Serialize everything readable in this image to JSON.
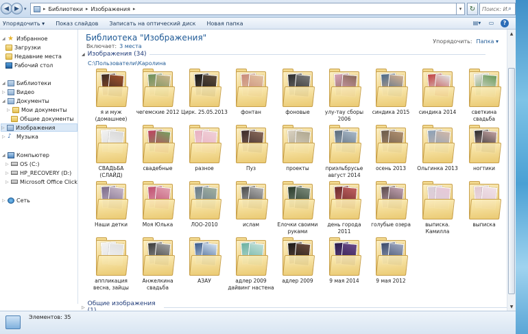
{
  "address": {
    "crumbs": [
      "Библиотеки",
      "Изображения"
    ],
    "search_placeholder": "Поиск: Из..."
  },
  "toolbar": {
    "buttons": [
      "Упорядочить ▾",
      "Показ слайдов",
      "Записать на оптический диск",
      "Новая папка"
    ]
  },
  "nav": {
    "items": [
      {
        "label": "Избранное",
        "icon": "star-icon"
      },
      {
        "label": "Загрузки",
        "icon": "folder-icon"
      },
      {
        "label": "Недавние места",
        "icon": "folder-icon"
      },
      {
        "label": "Рабочий стол",
        "icon": "desktop-icon"
      },
      {
        "label": "Библиотеки",
        "icon": "library-icon"
      },
      {
        "label": "Видео",
        "icon": "library-icon"
      },
      {
        "label": "Документы",
        "icon": "library-icon"
      },
      {
        "label": "Мои документы",
        "icon": "folder-icon"
      },
      {
        "label": "Общие документы",
        "icon": "folder-icon"
      },
      {
        "label": "Изображения",
        "icon": "library-icon"
      },
      {
        "label": "Музыка",
        "icon": "music-icon"
      },
      {
        "label": "Компьютер",
        "icon": "computer-icon"
      },
      {
        "label": "OS (C:)",
        "icon": "drive-icon"
      },
      {
        "label": "HP_RECOVERY (D:)",
        "icon": "drive-icon"
      },
      {
        "label": "Microsoft Office Click-to-Run",
        "icon": "drive-icon"
      },
      {
        "label": "Сеть",
        "icon": "network-icon"
      }
    ]
  },
  "content": {
    "title": "Библиотека \"Изображения\"",
    "includes_label": "Включает:",
    "includes_link": "3 места",
    "arrange_label": "Упорядочить:",
    "arrange_value": "Папка ▾",
    "group1": "Изображения (34)",
    "group1_path": "C:\\Пользователи\\Каролина",
    "group2": "Общие изображения (1)"
  },
  "folders": [
    {
      "name": "я и муж (домашнее)",
      "c1": "#3a2a22",
      "c2": "#a0522d"
    },
    {
      "name": "чегемские 2012",
      "c1": "#6b8f5a",
      "c2": "#c9b48a"
    },
    {
      "name": "Цирк. 25.05.2013",
      "c1": "#1a1a1a",
      "c2": "#5c4a3a"
    },
    {
      "name": "фонтан",
      "c1": "#c88a7a",
      "c2": "#e3c2a0"
    },
    {
      "name": "фоновые",
      "c1": "#2c2c2c",
      "c2": "#7a7a7a"
    },
    {
      "name": "улу-тау сборы 2006",
      "c1": "#d7a3b8",
      "c2": "#8a6a5a"
    },
    {
      "name": "синдика 2015",
      "c1": "#4a6a8a",
      "c2": "#d4b090"
    },
    {
      "name": "синдика 2014",
      "c1": "#c04040",
      "c2": "#e0e0e0"
    },
    {
      "name": "светкина свадьба",
      "c1": "#e8e4e0",
      "c2": "#6a9a5a"
    },
    {
      "name": "СВАДЬБА (СЛАЙД)",
      "c1": "#f2f2f2",
      "c2": "#d8d8d8"
    },
    {
      "name": "свадебные",
      "c1": "#c04060",
      "c2": "#78a060"
    },
    {
      "name": "разное",
      "c1": "#e8b0c0",
      "c2": "#f0d0d8"
    },
    {
      "name": "Пуз",
      "c1": "#3a2a2a",
      "c2": "#8a6a5a"
    },
    {
      "name": "проекты",
      "c1": "#d8d0c0",
      "c2": "#b0a890"
    },
    {
      "name": "приэльбрусье август 2014",
      "c1": "#5a6a7a",
      "c2": "#a8b8c8"
    },
    {
      "name": "осень 2013",
      "c1": "#6a5a4a",
      "c2": "#b09070"
    },
    {
      "name": "Ольгинка 2013",
      "c1": "#8aa0b8",
      "c2": "#d0b8a8"
    },
    {
      "name": "ногтики",
      "c1": "#2a2a2a",
      "c2": "#c0a0a0"
    },
    {
      "name": "Наши детки",
      "c1": "#7a6a8a",
      "c2": "#c8b8c8"
    },
    {
      "name": "Моя Юлька",
      "c1": "#c05070",
      "c2": "#e0a0b0"
    },
    {
      "name": "ЛОО-2010",
      "c1": "#6a7a8a",
      "c2": "#a0b0a0"
    },
    {
      "name": "ислам",
      "c1": "#4a4a4a",
      "c2": "#b0b0b0"
    },
    {
      "name": "Елочки своими руками",
      "c1": "#2a3a2a",
      "c2": "#7a8a7a"
    },
    {
      "name": "день города 2011",
      "c1": "#6a2a2a",
      "c2": "#c06060"
    },
    {
      "name": "голубые озера",
      "c1": "#5a4a4a",
      "c2": "#c0a0b0"
    },
    {
      "name": "выписка. Камилла",
      "c1": "#d8d0d8",
      "c2": "#e8c8d8"
    },
    {
      "name": "выписка",
      "c1": "#e0c8d0",
      "c2": "#f0e0e8"
    },
    {
      "name": "аппликация весна, зайцы",
      "c1": "#f2f2f2",
      "c2": "#e0e0e0"
    },
    {
      "name": "Анжелкина свадьба",
      "c1": "#3a3a3a",
      "c2": "#a0a0a0"
    },
    {
      "name": "АЗАУ",
      "c1": "#3a5a8a",
      "c2": "#d0e0f0"
    },
    {
      "name": "адлер 2009 дайвинг настена",
      "c1": "#6ab0a0",
      "c2": "#c0e0d8"
    },
    {
      "name": "адлер 2009",
      "c1": "#1a1a1a",
      "c2": "#6a4a3a"
    },
    {
      "name": "9 мая 2014",
      "c1": "#2a1a4a",
      "c2": "#6a4a8a"
    },
    {
      "name": "9 мая 2012",
      "c1": "#3a4a6a",
      "c2": "#a0a8c0"
    }
  ],
  "status": {
    "text": "Элементов: 35"
  }
}
